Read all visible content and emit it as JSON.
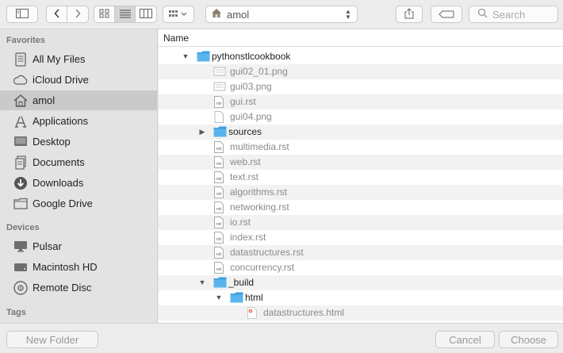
{
  "toolbar": {
    "location": "amol",
    "search_placeholder": "Search",
    "icons": [
      "sidebar-toggle-icon",
      "back-icon",
      "forward-icon",
      "icon-view-icon",
      "list-view-icon",
      "column-view-icon",
      "group-by-icon",
      "home-icon",
      "share-icon",
      "tag-icon",
      "search-icon"
    ]
  },
  "sidebar": {
    "favorites_title": "Favorites",
    "favorites": [
      {
        "label": "All My Files",
        "icon": "all-files-icon",
        "selected": false
      },
      {
        "label": "iCloud Drive",
        "icon": "cloud-icon",
        "selected": false
      },
      {
        "label": "amol",
        "icon": "home-icon",
        "selected": true
      },
      {
        "label": "Applications",
        "icon": "applications-icon",
        "selected": false
      },
      {
        "label": "Desktop",
        "icon": "desktop-icon",
        "selected": false
      },
      {
        "label": "Documents",
        "icon": "documents-icon",
        "selected": false
      },
      {
        "label": "Downloads",
        "icon": "downloads-icon",
        "selected": false
      },
      {
        "label": "Google Drive",
        "icon": "folder-icon",
        "selected": false
      }
    ],
    "devices_title": "Devices",
    "devices": [
      {
        "label": "Pulsar",
        "icon": "display-icon"
      },
      {
        "label": "Macintosh HD",
        "icon": "hard-drive-icon"
      },
      {
        "label": "Remote Disc",
        "icon": "disc-icon"
      }
    ],
    "tags_title": "Tags"
  },
  "list": {
    "column_name": "Name",
    "rows": [
      {
        "name": "pythonstlcookbook",
        "level": 0,
        "kind": "folder",
        "expanded": true,
        "dim": false
      },
      {
        "name": "gui02_01.png",
        "level": 1,
        "kind": "image",
        "dim": true
      },
      {
        "name": "gui03.png",
        "level": 1,
        "kind": "image",
        "dim": true
      },
      {
        "name": "gui.rst",
        "level": 1,
        "kind": "rst",
        "dim": true
      },
      {
        "name": "gui04.png",
        "level": 1,
        "kind": "blank",
        "dim": true
      },
      {
        "name": "sources",
        "level": 1,
        "kind": "folder",
        "expanded": false,
        "dim": false
      },
      {
        "name": "multimedia.rst",
        "level": 1,
        "kind": "rst",
        "dim": true
      },
      {
        "name": "web.rst",
        "level": 1,
        "kind": "rst",
        "dim": true
      },
      {
        "name": "text.rst",
        "level": 1,
        "kind": "rst",
        "dim": true
      },
      {
        "name": "algorithms.rst",
        "level": 1,
        "kind": "rst",
        "dim": true
      },
      {
        "name": "networking.rst",
        "level": 1,
        "kind": "rst",
        "dim": true
      },
      {
        "name": "io.rst",
        "level": 1,
        "kind": "rst",
        "dim": true
      },
      {
        "name": "index.rst",
        "level": 1,
        "kind": "rst",
        "dim": true
      },
      {
        "name": "datastructures.rst",
        "level": 1,
        "kind": "rst",
        "dim": true
      },
      {
        "name": "concurrency.rst",
        "level": 1,
        "kind": "rst",
        "dim": true
      },
      {
        "name": "_build",
        "level": 1,
        "kind": "folder",
        "expanded": true,
        "dim": false
      },
      {
        "name": "html",
        "level": 2,
        "kind": "folder",
        "expanded": true,
        "dim": false
      },
      {
        "name": "datastructures.html",
        "level": 3,
        "kind": "html",
        "dim": true
      }
    ],
    "rst_badge": "rst"
  },
  "footer": {
    "new_folder": "New Folder",
    "cancel": "Cancel",
    "choose": "Choose"
  }
}
